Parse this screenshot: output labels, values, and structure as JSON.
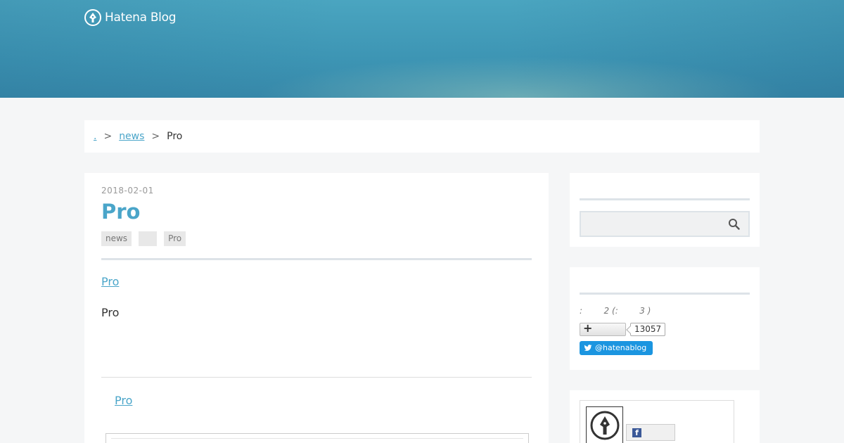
{
  "header": {
    "logo_text": "Hatena Blog"
  },
  "breadcrumb": {
    "items": [
      {
        "label": "."
      },
      {
        "label": "news"
      },
      {
        "label": "Pro"
      }
    ],
    "separator": ">"
  },
  "entry": {
    "date": "2018-02-01",
    "title": "Pro",
    "tags": [
      "news",
      "",
      "Pro"
    ],
    "body_link": "Pro",
    "body_text": "Pro",
    "related_link": "Pro"
  },
  "sidebar": {
    "search": {
      "placeholder": ""
    },
    "about": {
      "info": ":        2 (:        3 )",
      "bookmark_count": "13057",
      "twitter_handle": "@hatenablog"
    }
  },
  "colors": {
    "accent": "#4aa5c9",
    "header": "#3d95b4",
    "twitter": "#1b95e0",
    "facebook": "#3b5998"
  }
}
